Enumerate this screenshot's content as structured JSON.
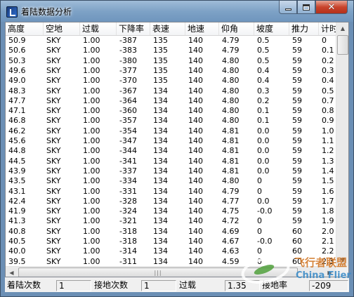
{
  "window": {
    "title": "着陆数据分析",
    "close_glyph": "✕"
  },
  "table": {
    "columns": [
      "高度",
      "空地",
      "过载",
      "下降率",
      "表速",
      "地速",
      "仰角",
      "坡度",
      "推力",
      "计时"
    ],
    "rows": [
      [
        "50.9",
        "SKY",
        "1.00",
        "-387",
        "135",
        "140",
        "4.79",
        "0.5",
        "59",
        "0"
      ],
      [
        "50.6",
        "SKY",
        "1.00",
        "-383",
        "135",
        "140",
        "4.79",
        "0.5",
        "59",
        "0.1"
      ],
      [
        "50.3",
        "SKY",
        "1.00",
        "-380",
        "135",
        "140",
        "4.80",
        "0.5",
        "59",
        "0.2"
      ],
      [
        "49.6",
        "SKY",
        "1.00",
        "-377",
        "135",
        "140",
        "4.80",
        "0.4",
        "59",
        "0.3"
      ],
      [
        "49.0",
        "SKY",
        "1.00",
        "-370",
        "135",
        "140",
        "4.80",
        "0.4",
        "59",
        "0.4"
      ],
      [
        "48.3",
        "SKY",
        "1.00",
        "-367",
        "134",
        "140",
        "4.80",
        "0.3",
        "59",
        "0.5"
      ],
      [
        "47.7",
        "SKY",
        "1.00",
        "-364",
        "134",
        "140",
        "4.80",
        "0.2",
        "59",
        "0.7"
      ],
      [
        "47.1",
        "SKY",
        "1.00",
        "-360",
        "134",
        "140",
        "4.80",
        "0.1",
        "59",
        "0.8"
      ],
      [
        "46.8",
        "SKY",
        "1.00",
        "-357",
        "134",
        "140",
        "4.80",
        "0.1",
        "59",
        "0.9"
      ],
      [
        "46.2",
        "SKY",
        "1.00",
        "-354",
        "134",
        "140",
        "4.81",
        "0.0",
        "59",
        "1.0"
      ],
      [
        "45.6",
        "SKY",
        "1.00",
        "-347",
        "134",
        "140",
        "4.81",
        "0.0",
        "59",
        "1.1"
      ],
      [
        "44.8",
        "SKY",
        "1.00",
        "-344",
        "134",
        "140",
        "4.81",
        "0.0",
        "59",
        "1.2"
      ],
      [
        "44.5",
        "SKY",
        "1.00",
        "-341",
        "134",
        "140",
        "4.81",
        "0.0",
        "59",
        "1.3"
      ],
      [
        "43.9",
        "SKY",
        "1.00",
        "-337",
        "134",
        "140",
        "4.81",
        "0.0",
        "59",
        "1.4"
      ],
      [
        "43.5",
        "SKY",
        "1.00",
        "-334",
        "134",
        "140",
        "4.80",
        "0",
        "59",
        "1.5"
      ],
      [
        "43.1",
        "SKY",
        "1.00",
        "-331",
        "134",
        "140",
        "4.79",
        "0",
        "59",
        "1.6"
      ],
      [
        "42.4",
        "SKY",
        "1.00",
        "-328",
        "134",
        "140",
        "4.77",
        "0.0",
        "59",
        "1.7"
      ],
      [
        "41.9",
        "SKY",
        "1.00",
        "-324",
        "134",
        "140",
        "4.75",
        "-0.0",
        "59",
        "1.8"
      ],
      [
        "41.3",
        "SKY",
        "1.00",
        "-321",
        "134",
        "140",
        "4.72",
        "0",
        "59",
        "1.9"
      ],
      [
        "40.8",
        "SKY",
        "1.00",
        "-318",
        "134",
        "140",
        "4.69",
        "0",
        "60",
        "2.0"
      ],
      [
        "40.5",
        "SKY",
        "1.00",
        "-318",
        "134",
        "140",
        "4.67",
        "-0.0",
        "60",
        "2.1"
      ],
      [
        "40.0",
        "SKY",
        "1.00",
        "-314",
        "134",
        "140",
        "4.63",
        "0",
        "60",
        "2.2"
      ],
      [
        "39.5",
        "SKY",
        "1.00",
        "-311",
        "134",
        "140",
        "4.59",
        "0",
        "60",
        "2.3"
      ]
    ]
  },
  "scrollbar": {
    "h_thumb_grip": "|||"
  },
  "status": {
    "fields": [
      {
        "label": "着陆次数",
        "value": "1"
      },
      {
        "label": "接地次数",
        "value": "1"
      },
      {
        "label": "过载",
        "value": "1.35"
      },
      {
        "label": "接地率",
        "value": "-209"
      }
    ]
  },
  "watermark": {
    "cn": "飞行者联盟",
    "en": "China Flier"
  },
  "colors": {
    "titlebar": "#7ea2c6",
    "close_button": "#c8442c"
  }
}
